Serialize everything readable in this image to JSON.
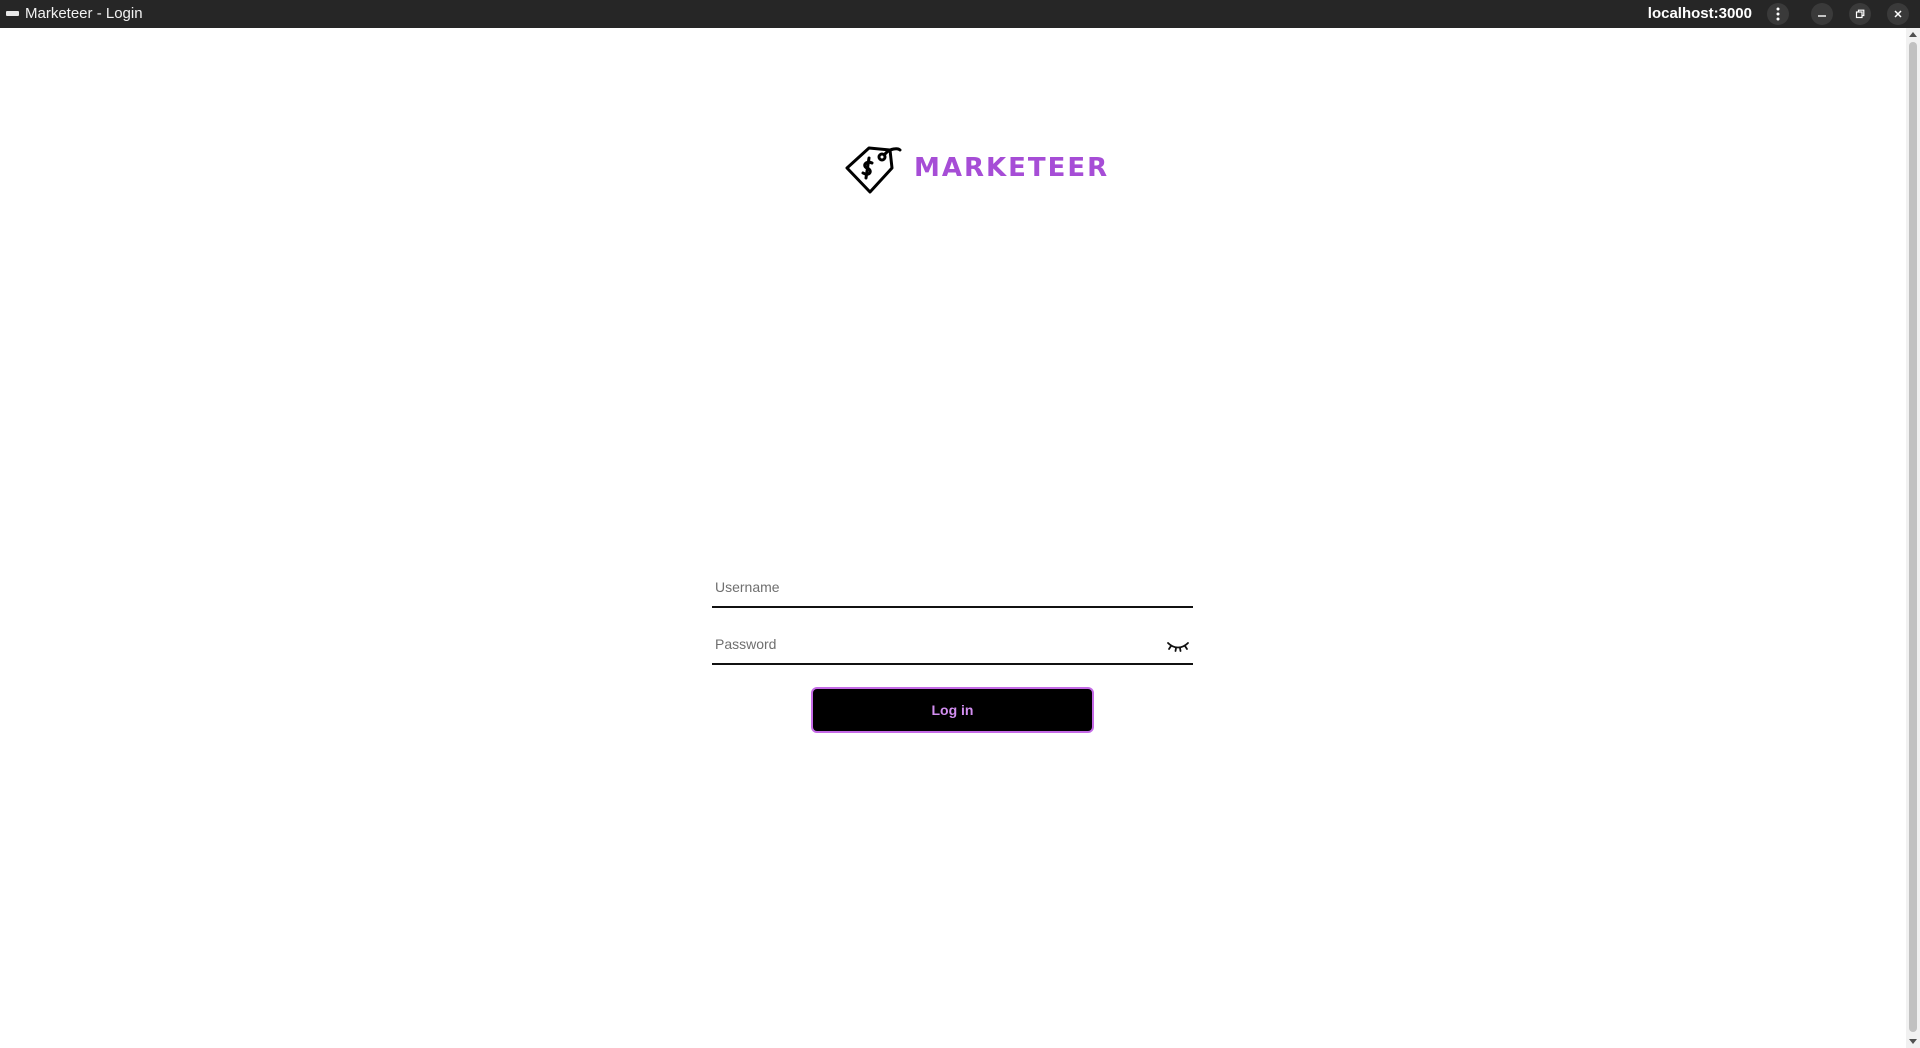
{
  "window": {
    "title": "Marketeer - Login",
    "host": "localhost:3000",
    "icons": [
      "app-icon",
      "kebab-menu-icon",
      "minimize-icon",
      "restore-icon",
      "close-icon"
    ]
  },
  "brand": {
    "name": "MARKETEER",
    "logo_icon": "price-tag-icon",
    "color": "#a64dd6"
  },
  "login_form": {
    "username": {
      "placeholder": "Username",
      "value": ""
    },
    "password": {
      "placeholder": "Password",
      "value": "",
      "toggle_icon": "eye-closed-icon"
    },
    "submit_label": "Log in",
    "button_bg": "#000000",
    "button_accent": "#c46ae6"
  }
}
